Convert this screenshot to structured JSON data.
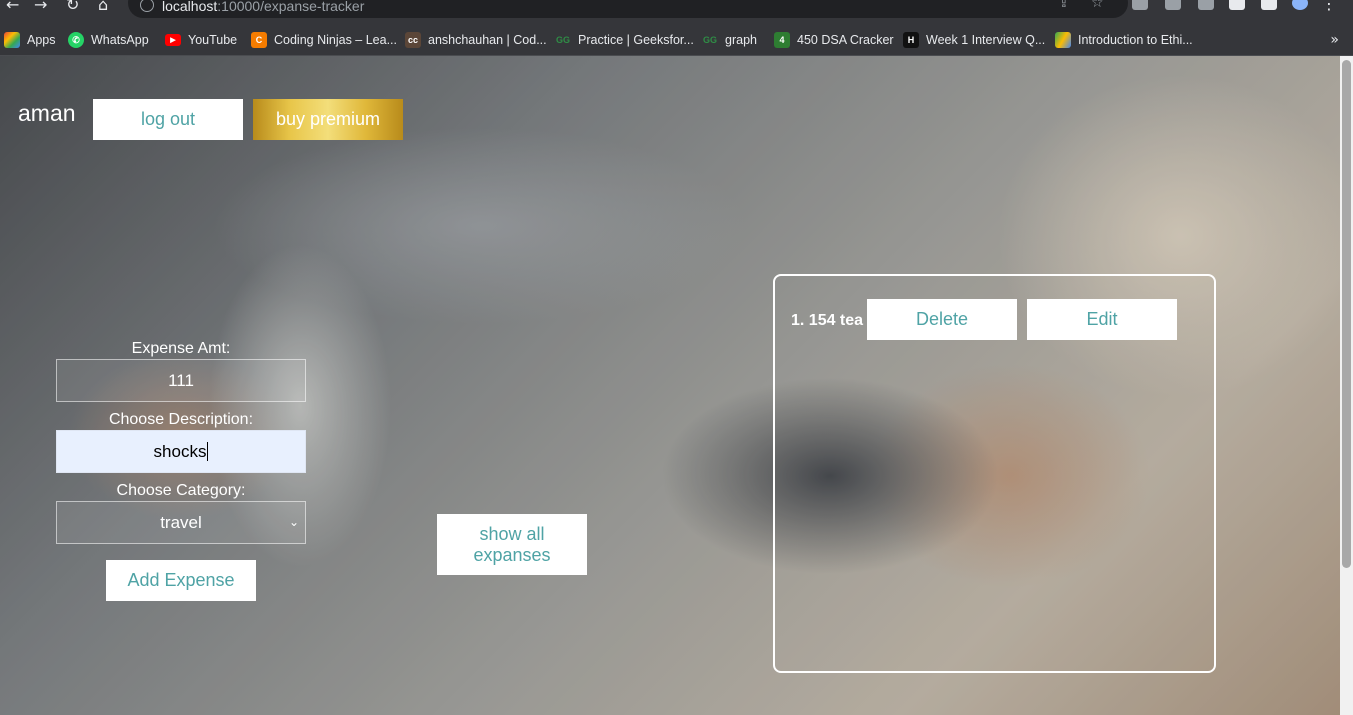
{
  "browser": {
    "url_host": "localhost",
    "url_path": ":10000/expanse-tracker",
    "bookmarks": [
      {
        "label": "Apps",
        "icon": "apps-grid-icon",
        "color": "#ea4335"
      },
      {
        "label": "WhatsApp",
        "icon": "whatsapp-icon",
        "color": "#25d366"
      },
      {
        "label": "YouTube",
        "icon": "youtube-icon",
        "color": "#ff0000"
      },
      {
        "label": "Coding Ninjas – Lea...",
        "icon": "coding-ninjas-icon",
        "color": "#f57c00"
      },
      {
        "label": "anshchauhan | Cod...",
        "icon": "codechef-icon",
        "color": "#5b4638"
      },
      {
        "label": "Practice | Geeksfor...",
        "icon": "geeksforgeeks-icon",
        "color": "#2f8d46"
      },
      {
        "label": "graph",
        "icon": "geeksforgeeks-icon",
        "color": "#2f8d46"
      },
      {
        "label": "450 DSA Cracker",
        "icon": "dsa-cracker-icon",
        "color": "#2e7d32"
      },
      {
        "label": "Week 1 Interview Q...",
        "icon": "hackerrank-icon",
        "color": "#111111"
      },
      {
        "label": "Introduction to Ethi...",
        "icon": "google-drive-icon",
        "color": "#fbbc04"
      }
    ]
  },
  "header": {
    "username": "aman",
    "logout_label": "log out",
    "premium_label": "buy premium"
  },
  "form": {
    "amount_label": "Expense Amt:",
    "amount_value": "111",
    "description_label": "Choose Description:",
    "description_value": "shocks",
    "category_label": "Choose Category:",
    "category_value": "travel",
    "submit_label": "Add Expense"
  },
  "show_all_label": "show all expanses",
  "expenses": [
    {
      "text": "1. 154 tea",
      "delete_label": "Delete",
      "edit_label": "Edit"
    }
  ],
  "colors": {
    "button_text": "#4fa3a5",
    "premium_gold": "#e8c64a"
  }
}
